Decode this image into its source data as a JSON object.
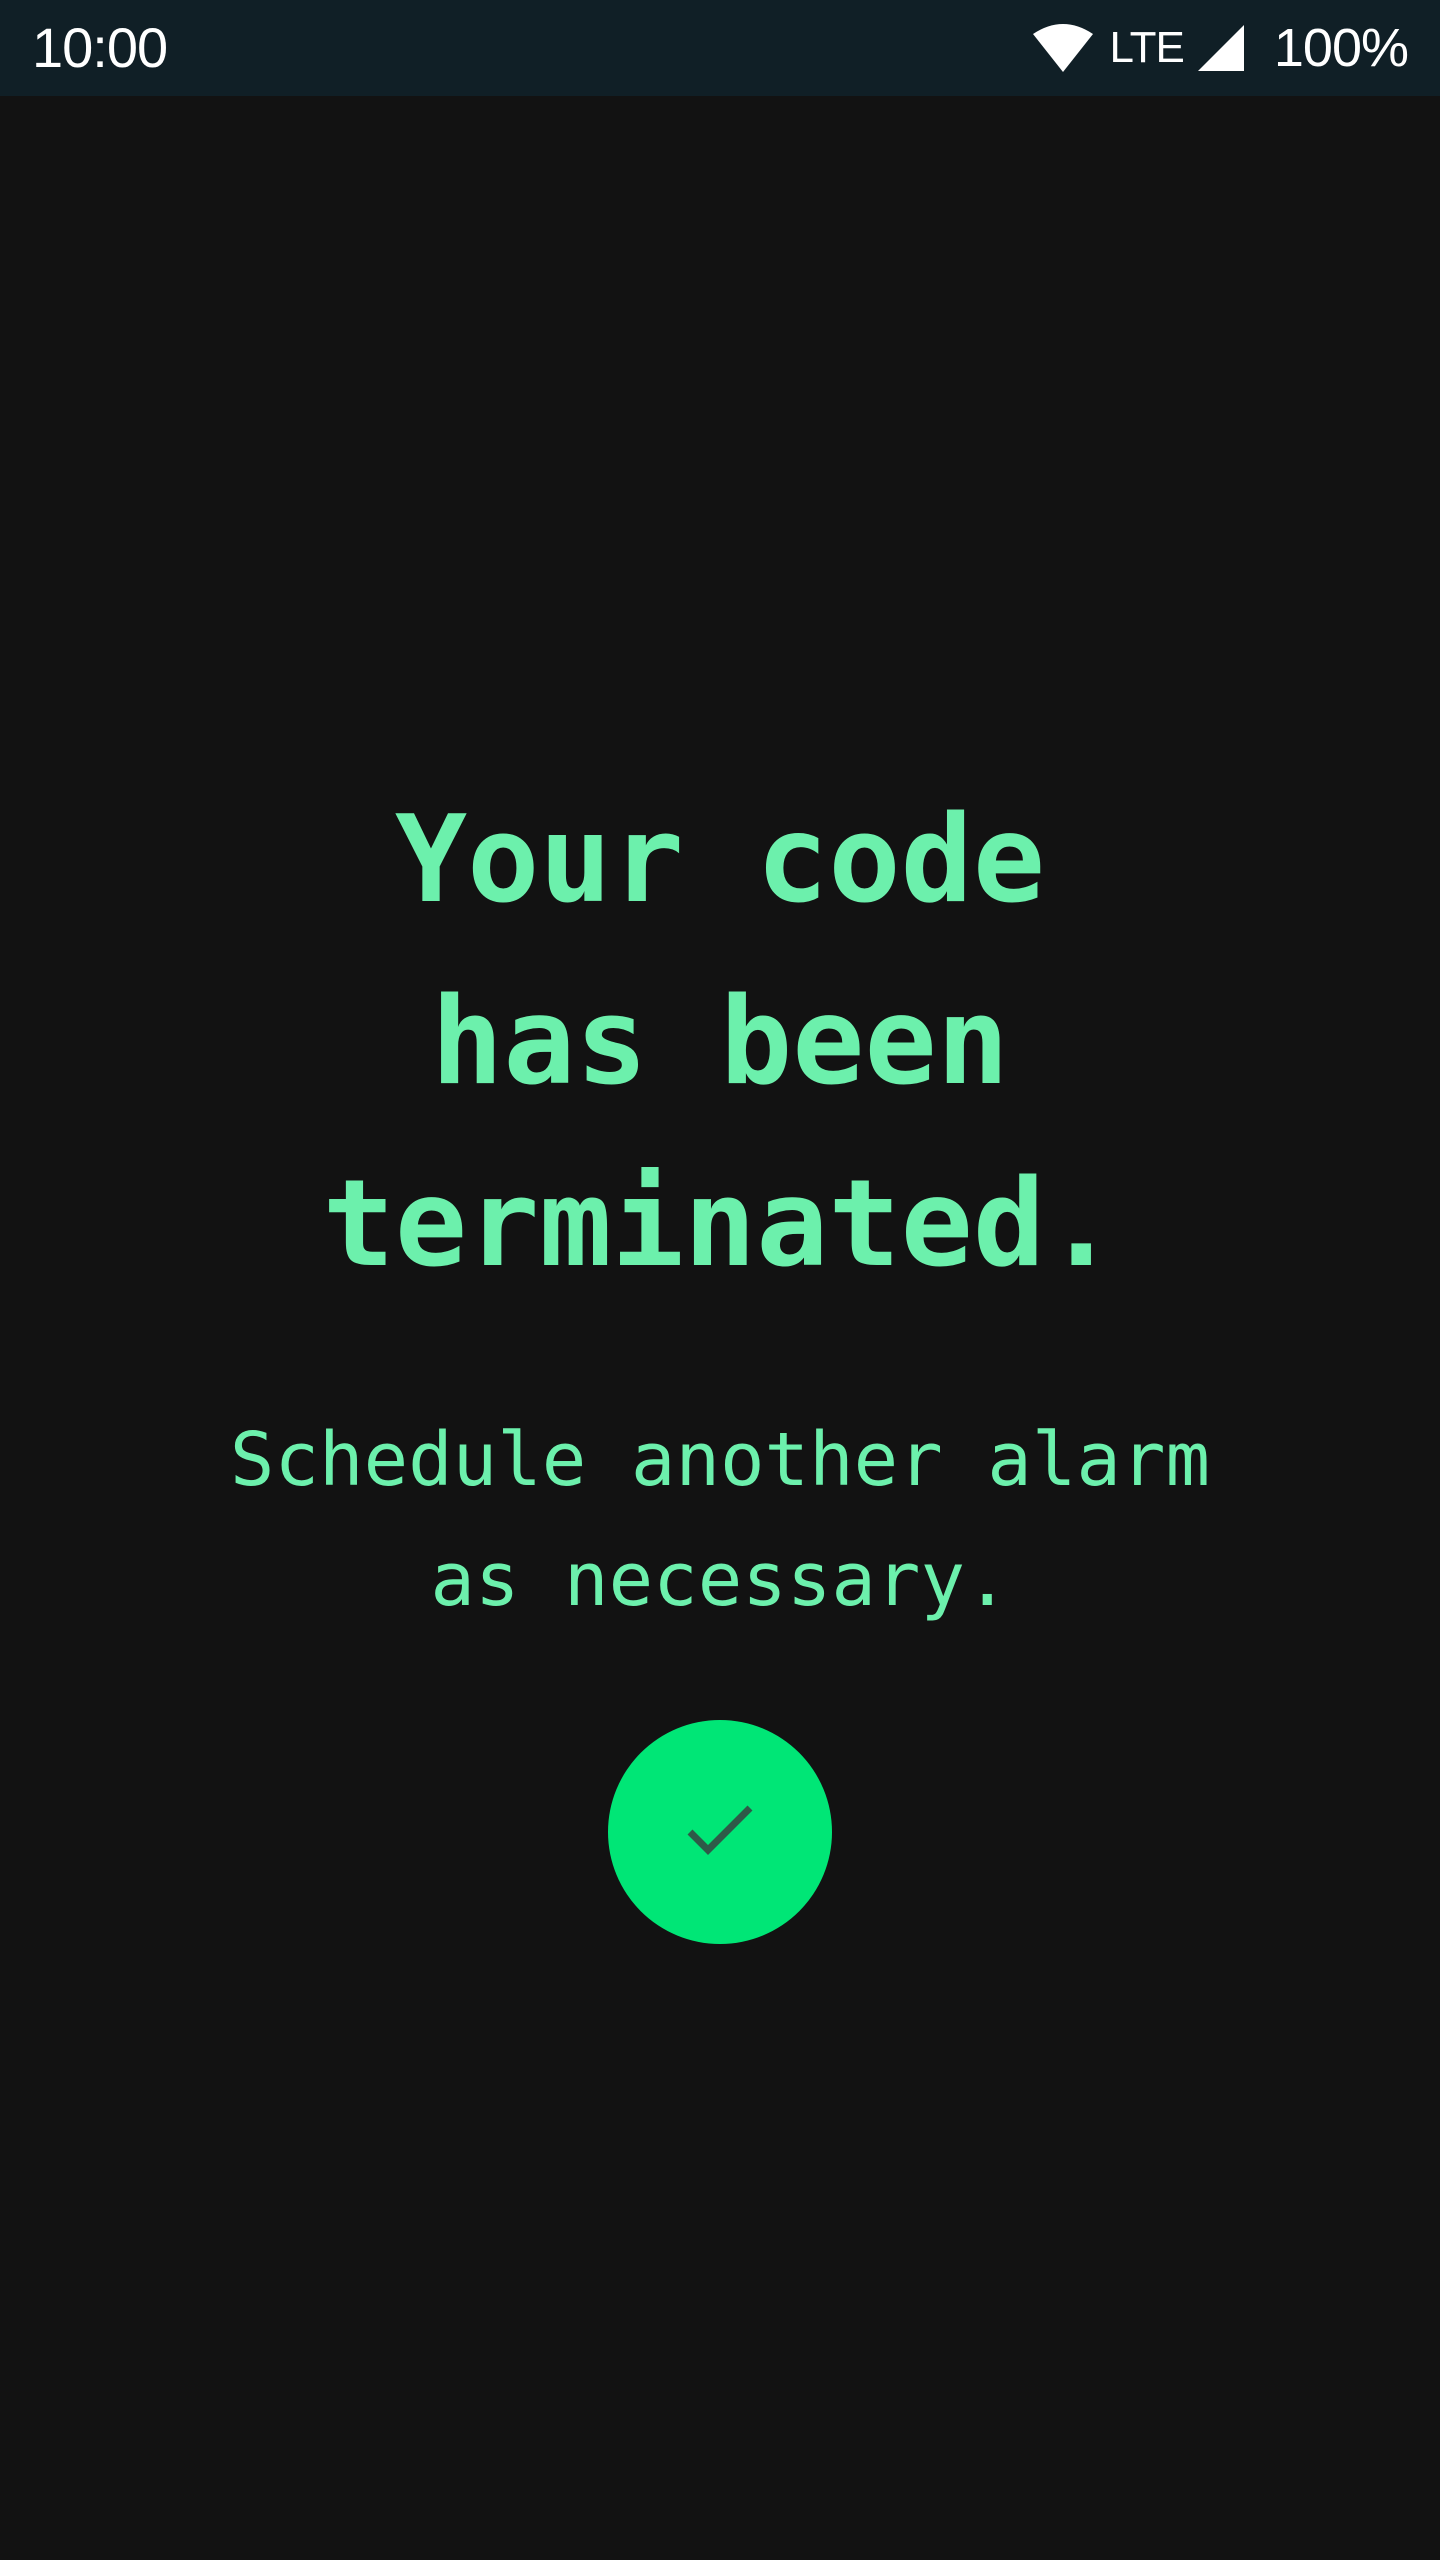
{
  "status_bar": {
    "time": "10:00",
    "network_label": "LTE",
    "battery_label": "100%",
    "icons": [
      "wifi-icon",
      "cell-signal-icon"
    ]
  },
  "main": {
    "headline_lines": [
      "Your code",
      "has been",
      "terminated."
    ],
    "subtext_lines": [
      "Schedule another alarm",
      "as necessary."
    ],
    "confirm_button_icon": "check-icon"
  },
  "colors": {
    "status_bar_bg": "#101f26",
    "background": "#121212",
    "accent_text": "#6cf0ac",
    "button_fill": "#00e676",
    "check_stroke": "#2e5a48"
  }
}
